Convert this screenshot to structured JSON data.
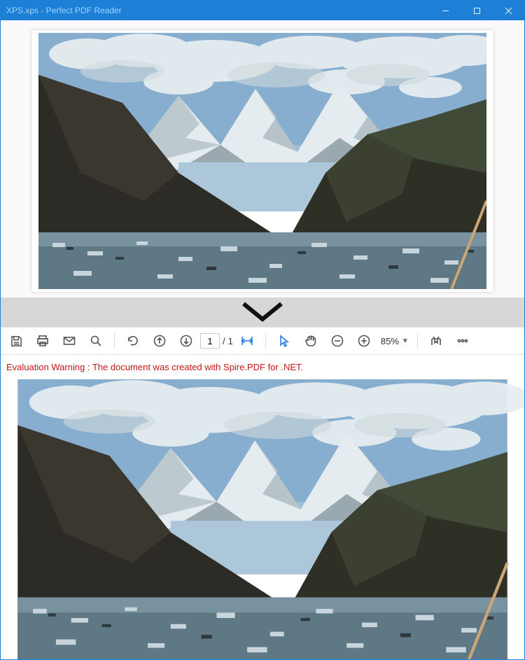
{
  "window": {
    "title": "XPS.xps - Perfect PDF Reader"
  },
  "toolbar": {
    "page_current": "1",
    "page_separator": "/",
    "page_total": "1",
    "zoom_value": "85%"
  },
  "warning": {
    "text": "Evaluation Warning : The document was created with Spire.PDF for .NET."
  }
}
